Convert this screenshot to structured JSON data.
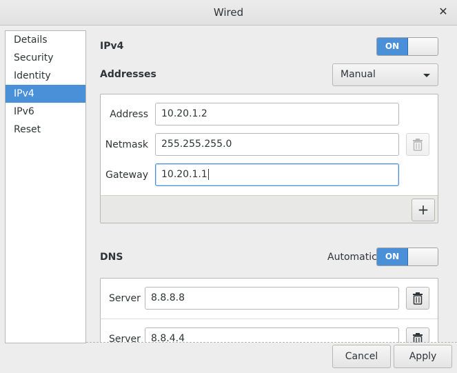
{
  "window": {
    "title": "Wired"
  },
  "sidebar": {
    "items": [
      {
        "label": "Details"
      },
      {
        "label": "Security"
      },
      {
        "label": "Identity"
      },
      {
        "label": "IPv4"
      },
      {
        "label": "IPv6"
      },
      {
        "label": "Reset"
      }
    ],
    "selected": "IPv4"
  },
  "ipv4": {
    "heading": "IPv4",
    "switch_label": "ON",
    "addresses_heading": "Addresses",
    "method": "Manual",
    "rows": {
      "address_label": "Address",
      "address_value": "10.20.1.2",
      "netmask_label": "Netmask",
      "netmask_value": "255.255.255.0",
      "gateway_label": "Gateway",
      "gateway_value": "10.20.1.1"
    },
    "add_label": "+"
  },
  "dns": {
    "heading": "DNS",
    "automatic_label": "Automatic",
    "switch_label": "ON",
    "servers": [
      {
        "label": "Server",
        "value": "8.8.8.8"
      },
      {
        "label": "Server",
        "value": "8.8.4.4"
      }
    ]
  },
  "buttons": {
    "cancel": "Cancel",
    "apply": "Apply"
  },
  "colors": {
    "accent": "#4a90d9",
    "window_bg": "#ededed",
    "border": "#b6b6b3"
  },
  "icons": [
    "close-icon",
    "trash-icon",
    "plus-icon",
    "chevron-down-icon"
  ]
}
